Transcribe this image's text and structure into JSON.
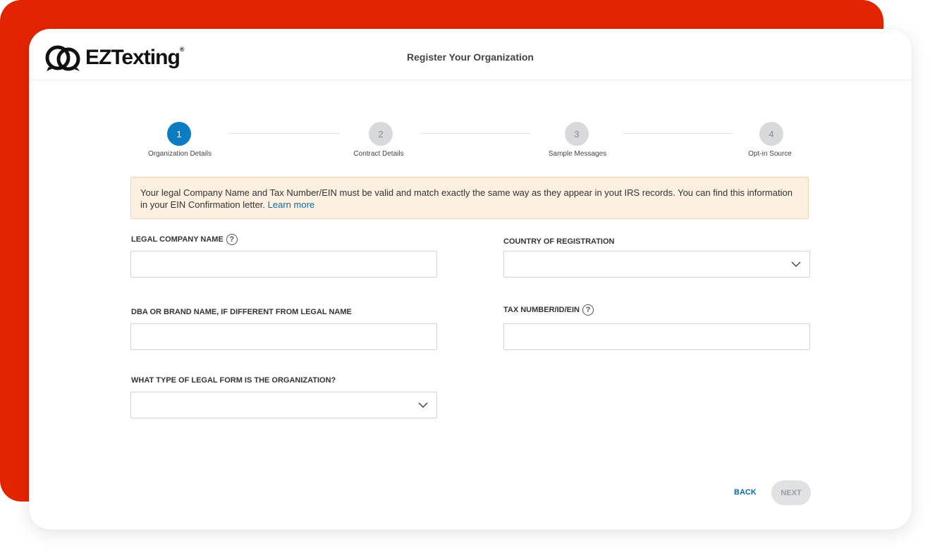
{
  "brand": {
    "name": "EZTexting",
    "registered_mark": "®",
    "accent": "#e32400"
  },
  "header": {
    "title": "Register Your Organization"
  },
  "stepper": {
    "active_color": "#0b7cc1",
    "steps": [
      {
        "number": "1",
        "label": "Organization Details",
        "active": true
      },
      {
        "number": "2",
        "label": "Contract Details",
        "active": false
      },
      {
        "number": "3",
        "label": "Sample Messages",
        "active": false
      },
      {
        "number": "4",
        "label": "Opt-in Source",
        "active": false
      }
    ]
  },
  "notice": {
    "text": "Your legal Company Name and Tax Number/EIN must be valid and match exactly the same way as they appear in yout IRS records. You can find this information in your EIN Confirmation letter.",
    "link": "Learn more"
  },
  "form": {
    "legal_company_name": {
      "label": "LEGAL COMPANY NAME",
      "value": "",
      "help_icon": "question-circle-icon"
    },
    "country": {
      "label": "COUNTRY OF REGISTRATION",
      "value": ""
    },
    "dba": {
      "label": "DBA OR BRAND NAME, IF DIFFERENT FROM LEGAL NAME",
      "value": ""
    },
    "tax_number": {
      "label": "TAX NUMBER/ID/EIN",
      "value": "",
      "help_icon": "question-circle-icon"
    },
    "legal_form": {
      "label": "WHAT TYPE OF LEGAL FORM IS THE ORGANIZATION?",
      "value": ""
    }
  },
  "actions": {
    "back": "BACK",
    "next": "NEXT"
  }
}
